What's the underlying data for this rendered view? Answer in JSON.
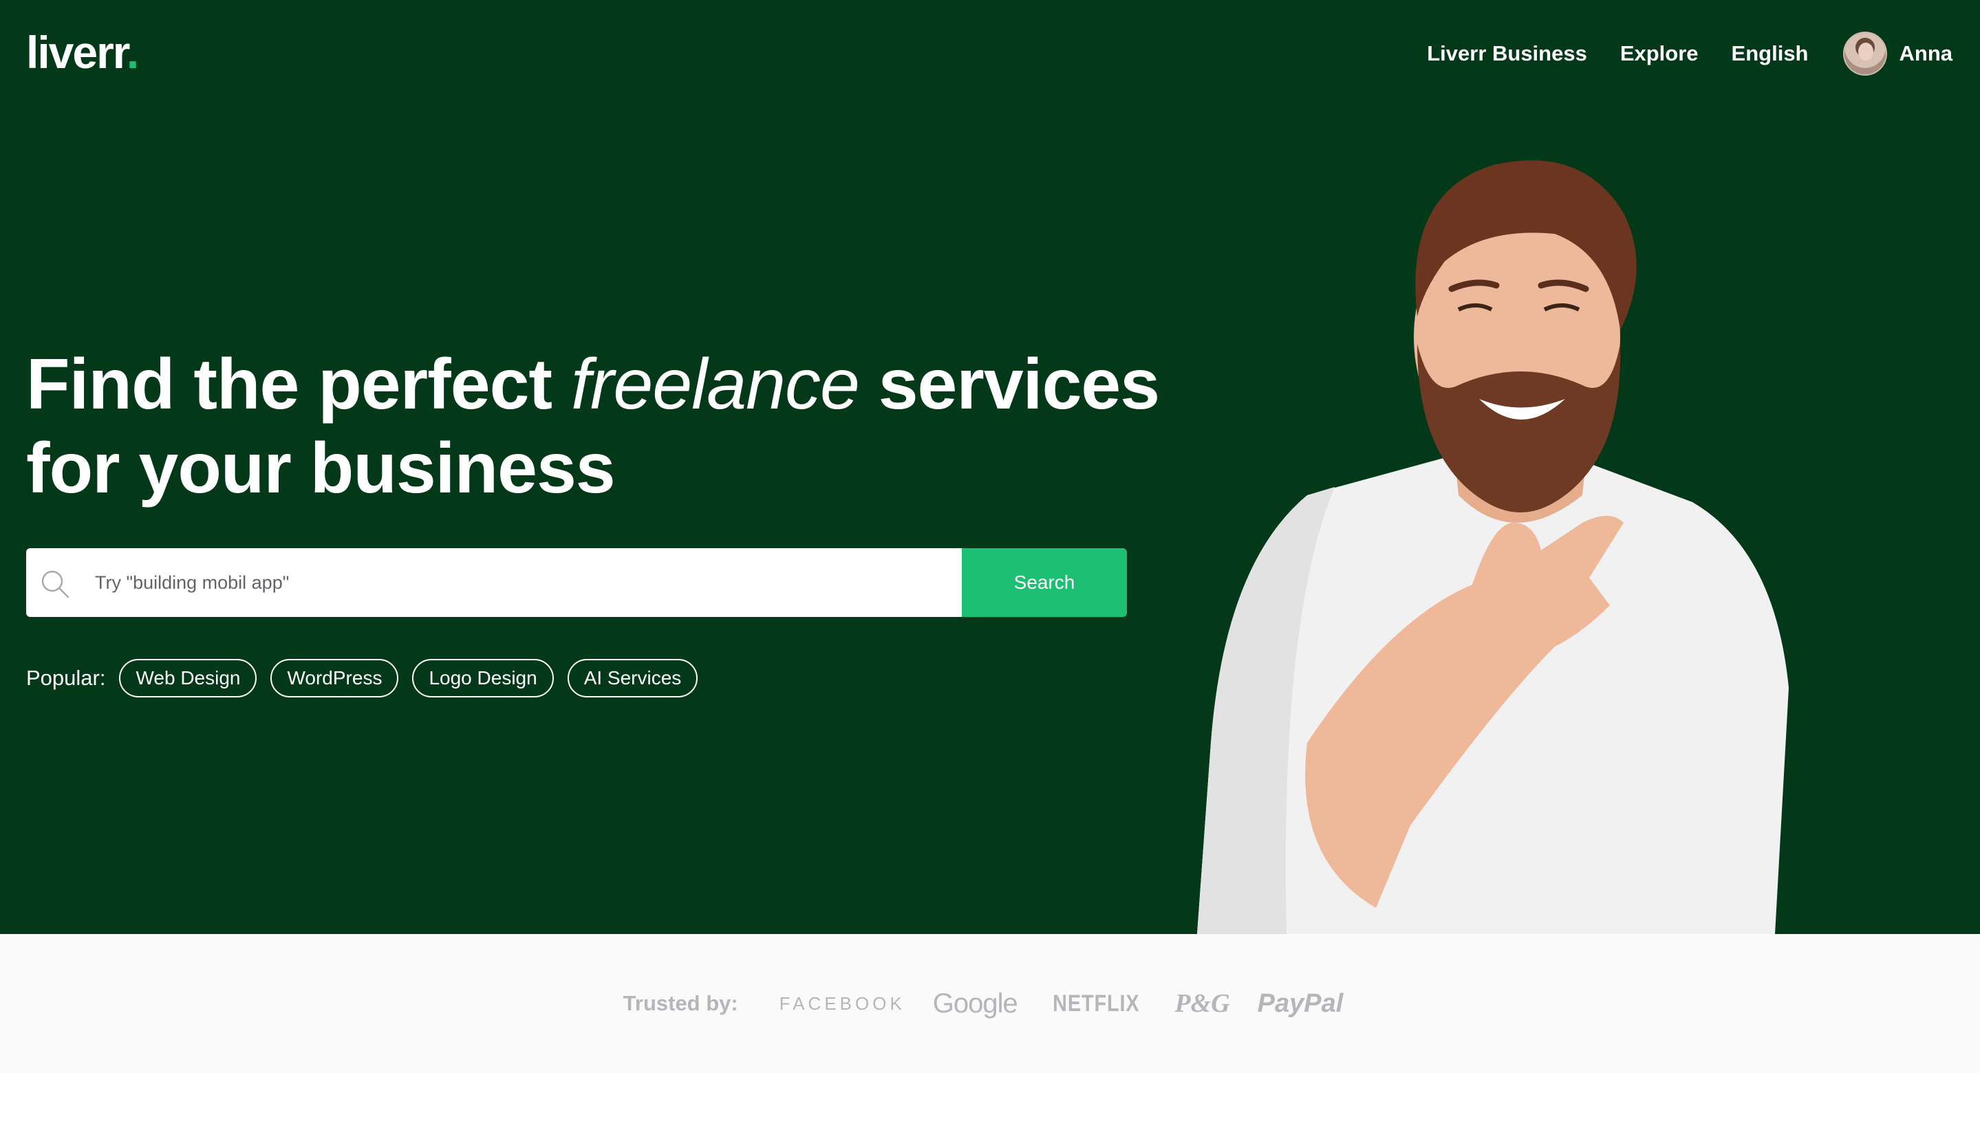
{
  "header": {
    "logo_text": "liverr",
    "logo_dot": ".",
    "nav": [
      "Liverr Business",
      "Explore",
      "English"
    ],
    "user_name": "Anna"
  },
  "hero": {
    "headline_part1": "Find the perfect ",
    "headline_italic": "freelance",
    "headline_part2": " services",
    "headline_line2": "for your business",
    "search": {
      "placeholder": "Try \"building mobil app\"",
      "value": "",
      "button_label": "Search"
    },
    "popular": {
      "label": "Popular:",
      "tags": [
        "Web Design",
        "WordPress",
        "Logo Design",
        "AI Services"
      ]
    },
    "background_color": "#033818",
    "accent_color": "#1dbf73"
  },
  "trusted": {
    "label": "Trusted by:",
    "brands": [
      "FACEBOOK",
      "Google",
      "NETFLIX",
      "P&G",
      "PayPal"
    ]
  }
}
